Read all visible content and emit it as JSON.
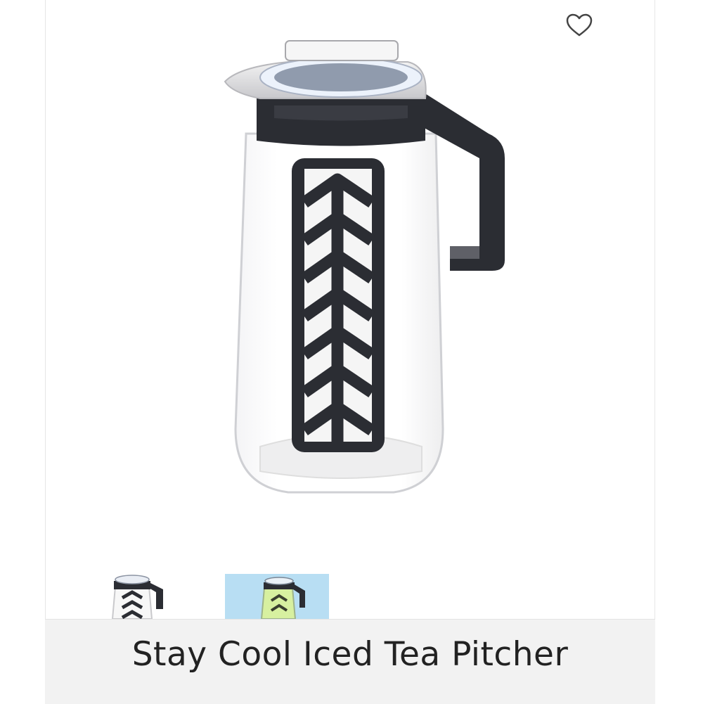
{
  "product": {
    "title": "Stay Cool Iced Tea Pitcher",
    "image_alt": "pitcher-image"
  },
  "favorite": {
    "icon": "heart-outline-icon"
  },
  "thumbnails": [
    {
      "name": "thumbnail-1",
      "selected": true
    },
    {
      "name": "thumbnail-2",
      "selected": false
    }
  ],
  "colors": {
    "pitcher_dark": "#2b2d33",
    "lid_light": "#e6e6e6",
    "thumb_bg": "#b8def3"
  }
}
